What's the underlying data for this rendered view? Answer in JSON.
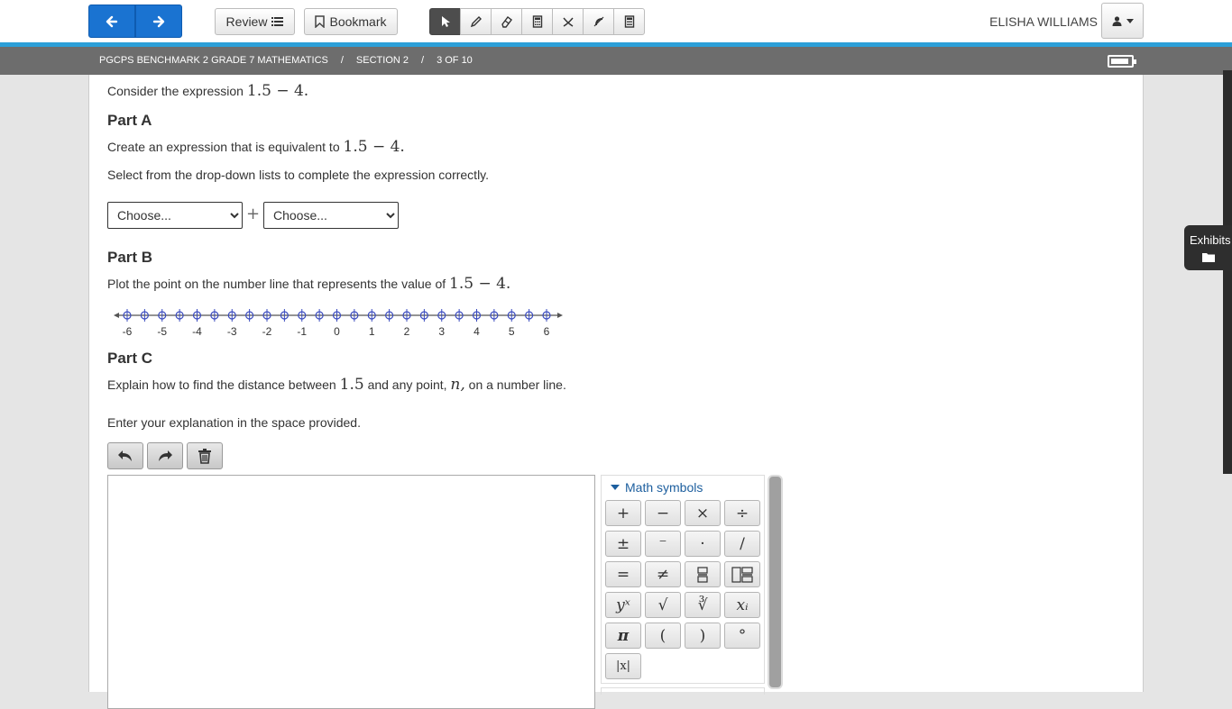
{
  "toolbar": {
    "review_label": "Review",
    "bookmark_label": "Bookmark",
    "user_name": "ELISHA WILLIAMS"
  },
  "breadcrumb": {
    "test": "PGCPS BENCHMARK 2 GRADE 7 MATHEMATICS",
    "sep1": "/",
    "section": "SECTION 2",
    "sep2": "/",
    "position": "3 OF 10"
  },
  "question": {
    "intro_text": "Consider the expression",
    "intro_math": "1.5 − 4.",
    "part_a": {
      "heading": "Part A",
      "line1_text": "Create an expression that is equivalent to",
      "line1_math": "1.5 − 4.",
      "line2": "Select from the drop-down lists to complete the expression correctly.",
      "dropdown1": "Choose...",
      "operator": "+",
      "dropdown2": "Choose..."
    },
    "part_b": {
      "heading": "Part B",
      "line_text": "Plot the point on the number line that represents the value of",
      "line_math": "1.5 − 4.",
      "number_line": {
        "min": -6,
        "max": 6,
        "step": 0.5,
        "labels": [
          "-6",
          "-5",
          "-4",
          "-3",
          "-2",
          "-1",
          "0",
          "1",
          "2",
          "3",
          "4",
          "5",
          "6"
        ]
      }
    },
    "part_c": {
      "heading": "Part C",
      "line1_a": "Explain how to find the distance between",
      "line1_m1": "1.5",
      "line1_b": "and any point,",
      "line1_m2": "n,",
      "line1_c": "on a number line.",
      "line2": "Enter your explanation in the space provided."
    }
  },
  "palette": {
    "title": "Math symbols",
    "symbols": [
      "+",
      "−",
      "×",
      "÷",
      "±",
      "⁻",
      "·",
      "/",
      "=",
      "≠",
      "",
      "",
      "yˣ",
      "√",
      "∛",
      "xᵢ",
      "π",
      "(",
      ")",
      "°",
      "|x|"
    ]
  },
  "exhibits": {
    "label": "Exhibits"
  },
  "colors": {
    "nav_blue": "#1a73d1",
    "accent_line": "#2c9fd8",
    "breadcrumb_bar": "#6d6d6d",
    "number_line_point": "#3a4bbf"
  }
}
